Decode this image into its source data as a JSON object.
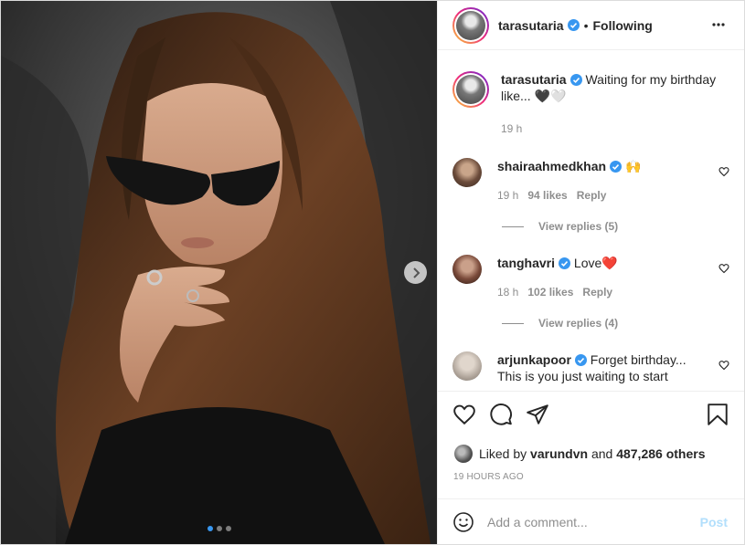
{
  "post": {
    "username": "tarasutaria",
    "follow_status": "Following",
    "bullet": "•",
    "media": {
      "image_alt": "photo-of-woman-with-sunglasses",
      "carousel_count": 3,
      "active_index": 0
    },
    "caption": {
      "username": "tarasutaria",
      "text": "Waiting for my birthday like... 🖤🤍",
      "time": "19 h"
    },
    "comments": [
      {
        "username": "shairaahmedkhan",
        "verified": true,
        "text": "🙌",
        "time": "19 h",
        "likes": "94 likes",
        "reply_label": "Reply",
        "view_replies": "View replies (5)"
      },
      {
        "username": "tanghavri",
        "verified": true,
        "text": "Love❤️",
        "time": "18 h",
        "likes": "102 likes",
        "reply_label": "Reply",
        "view_replies": "View replies (4)"
      },
      {
        "username": "arjunkapoor",
        "verified": true,
        "text": "Forget birthday...",
        "text2": "This is you just waiting to start"
      }
    ],
    "liked_by_prefix": "Liked by",
    "liked_by_user": "varundvn",
    "liked_by_and": "and",
    "liked_by_others": "487,286 others",
    "timestamp": "19 HOURS AGO",
    "add_comment_placeholder": "Add a comment...",
    "post_button": "Post",
    "colors": {
      "accent": "#3897f0",
      "post_disabled": "#b2dffc",
      "heart_red": "#ed4956"
    },
    "icons": [
      "more-icon",
      "verified-icon",
      "heart-icon",
      "comment-icon",
      "share-icon",
      "bookmark-icon",
      "emoji-icon",
      "chevron-right-icon"
    ]
  }
}
